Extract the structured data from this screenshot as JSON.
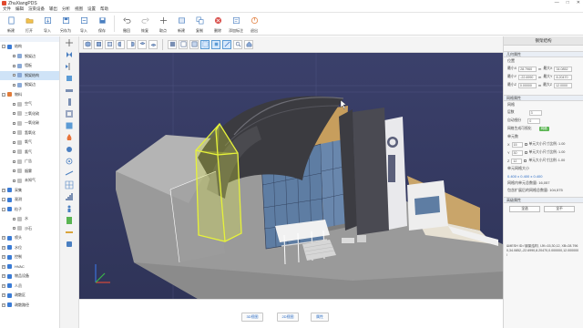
{
  "app": {
    "title": "ZhuXiangPDS",
    "window_buttons": [
      "—",
      "□",
      "✕"
    ]
  },
  "menu": [
    "文件",
    "编辑",
    "渲染设备",
    "输出",
    "分析",
    "视图",
    "设置",
    "帮助"
  ],
  "toolbar": [
    {
      "label": "新建",
      "icon": "new-file-icon"
    },
    {
      "label": "打开",
      "icon": "folder-open-icon"
    },
    {
      "label": "导入",
      "icon": "import-icon"
    },
    {
      "label": "另存为",
      "icon": "save-as-icon"
    },
    {
      "label": "导入",
      "icon": "import-file-icon"
    },
    {
      "label": "保存",
      "icon": "save-icon"
    },
    {
      "label": "撤回",
      "icon": "undo-icon"
    },
    {
      "label": "恢复",
      "icon": "redo-icon"
    },
    {
      "label": "取点",
      "icon": "pick-point-icon"
    },
    {
      "label": "新建",
      "icon": "new-object-icon"
    },
    {
      "label": "复制",
      "icon": "copy-icon"
    },
    {
      "label": "删除",
      "icon": "delete-icon"
    },
    {
      "label": "添加标注",
      "icon": "annotate-icon"
    },
    {
      "label": "退出",
      "icon": "exit-icon"
    }
  ],
  "tree": [
    {
      "label": "结构",
      "level": 1,
      "expander": "-",
      "color": "#3a7bd5"
    },
    {
      "label": "钢架边",
      "level": 2,
      "color": "#8aa9d6"
    },
    {
      "label": "墙板",
      "level": 2,
      "color": "#8aa9d6"
    },
    {
      "label": "钢架结构",
      "level": 2,
      "color": "#8aa9d6",
      "selected": true
    },
    {
      "label": "钢架边",
      "level": 2,
      "color": "#8aa9d6"
    },
    {
      "label": "物料",
      "level": 1,
      "expander": "-",
      "color": "#e07b39"
    },
    {
      "label": "空气",
      "level": 2,
      "color": "#c0c0c0"
    },
    {
      "label": "三氧化硫",
      "level": 2,
      "color": "#c0c0c0"
    },
    {
      "label": "一氧化碳",
      "level": 2,
      "color": "#c0c0c0"
    },
    {
      "label": "氢氧化",
      "level": 2,
      "color": "#c0c0c0"
    },
    {
      "label": "氧气",
      "level": 2,
      "color": "#c0c0c0"
    },
    {
      "label": "氯气",
      "level": 2,
      "color": "#c0c0c0"
    },
    {
      "label": "广告",
      "level": 2,
      "color": "#c0c0c0"
    },
    {
      "label": "烟雾",
      "level": 2,
      "color": "#c0c0c0"
    },
    {
      "label": "未知气",
      "level": 2,
      "color": "#c0c0c0"
    },
    {
      "label": "采集",
      "level": 1,
      "expander": "+",
      "color": "#3a7bd5"
    },
    {
      "label": "观测",
      "level": 1,
      "expander": "-",
      "color": "#3a7bd5"
    },
    {
      "label": "粒子",
      "level": 1,
      "expander": "-",
      "color": "#3a7bd5"
    },
    {
      "label": "水",
      "level": 2,
      "color": "#c0c0c0"
    },
    {
      "label": "沙石",
      "level": 2,
      "color": "#c0c0c0"
    },
    {
      "label": "喷头",
      "level": 1,
      "expander": "+",
      "color": "#3a7bd5"
    },
    {
      "label": "水位",
      "level": 1,
      "expander": "+",
      "color": "#3a7bd5"
    },
    {
      "label": "控制",
      "level": 1,
      "expander": "+",
      "color": "#3a7bd5"
    },
    {
      "label": "HVAC",
      "level": 1,
      "expander": "+",
      "color": "#3a7bd5"
    },
    {
      "label": "物品设备",
      "level": 1,
      "expander": "+",
      "color": "#3a7bd5"
    },
    {
      "label": "人员",
      "level": 1,
      "expander": "+",
      "color": "#3a7bd5"
    },
    {
      "label": "疏散区",
      "level": 1,
      "expander": "+",
      "color": "#3a7bd5"
    },
    {
      "label": "疏散路径",
      "level": 1,
      "expander": "+",
      "color": "#3a7bd5"
    }
  ],
  "right_panel": {
    "title": "钢架结构",
    "section_geometry": "几何属性",
    "position_label": "位置",
    "coords": [
      {
        "axis": "最小X",
        "min": "28.7960",
        "max_label": "最大X",
        "max": "34.0852"
      },
      {
        "axis": "最小Y",
        "min": "-22.6990",
        "max_label": "最大Y",
        "max": "8.20470"
      },
      {
        "axis": "最小Z",
        "min": "0.00000",
        "max_label": "最大Z",
        "max": "12.0000"
      }
    ],
    "unit": "m",
    "section_props": "网格属性",
    "mesh_label": "网格",
    "layer_label": "层数",
    "layer_value": "3",
    "subdivide_label": "自动细分",
    "subdivide_value": "0",
    "mesh_show_label": "网格生成可视化",
    "mesh_show_value": "网格",
    "cells_label": "单元数",
    "cells": [
      {
        "axis": "X",
        "value": "15",
        "opt": "单元大小尺寸比例: 1.00"
      },
      {
        "axis": "Y",
        "value": "30",
        "opt": "单元大小尺寸比例: 1.00"
      },
      {
        "axis": "Z",
        "value": "12",
        "opt": "单元大小尺寸比例: 1.00"
      }
    ],
    "cell_size_label": "单元网格大小",
    "cell_size_value": "0.400 x 0.400 x 0.400",
    "cells_count": "网格内单元总数量: 16,057",
    "cells_extended": "包含扩展后的网格总数量: 104,575",
    "section_advanced": "高级属性",
    "adv_buttons": [
      "全选",
      "全不"
    ],
    "note": "&MESH ID='钢架结构', IJK=15,30,12, XB=28.7960,34.0852,-22.6990,8.20470,0.000000,12.000000 /"
  },
  "statusbar_buttons": [
    "3D视图",
    "2D视图",
    "属性"
  ],
  "colors": {
    "viewport_bg": "#3a3f66",
    "selection": "#e6f23a",
    "accent": "#2d6dc4"
  }
}
